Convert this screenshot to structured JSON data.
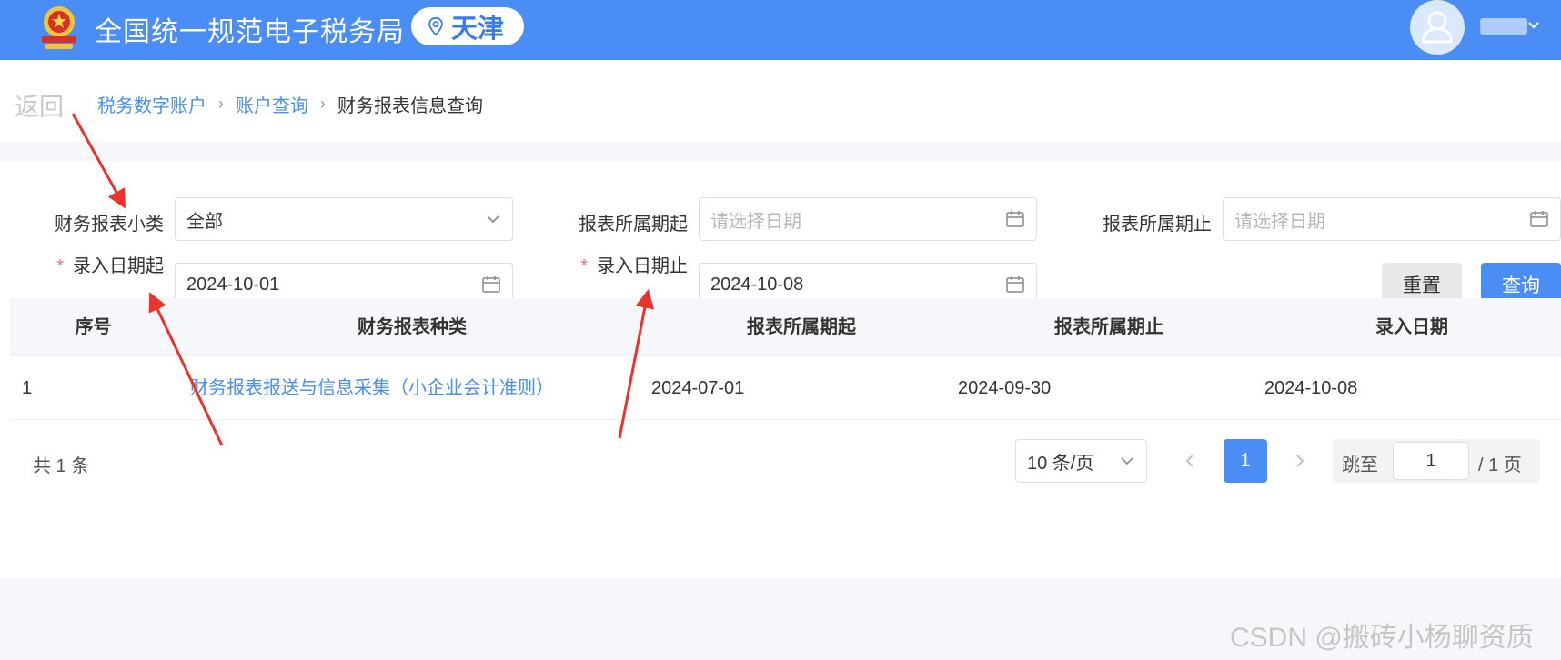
{
  "header": {
    "app_title": "全国统一规范电子税务局",
    "region": "天津",
    "emblem_icon": "tax-emblem-icon",
    "user_icon": "user-avatar-icon"
  },
  "breadcrumb": {
    "back": "返回",
    "items": [
      "税务数字账户",
      "账户查询"
    ],
    "current": "财务报表信息查询"
  },
  "filters": {
    "report_subtype": {
      "label": "财务报表小类",
      "value": "全部"
    },
    "period_start": {
      "label": "报表所属期起",
      "placeholder": "请选择日期"
    },
    "period_end": {
      "label": "报表所属期止",
      "placeholder": "请选择日期"
    },
    "entry_start": {
      "required": "*",
      "label": "录入日期起",
      "value": "2024-10-01"
    },
    "entry_end": {
      "required": "*",
      "label": "录入日期止",
      "value": "2024-10-08"
    },
    "reset_label": "重置",
    "query_label": "查询"
  },
  "table": {
    "columns": [
      "序号",
      "财务报表种类",
      "报表所属期起",
      "报表所属期止",
      "录入日期"
    ],
    "rows": [
      [
        "1",
        "财务报表报送与信息采集（小企业会计准则）",
        "2024-07-01",
        "2024-09-30",
        "2024-10-08"
      ]
    ]
  },
  "pagination": {
    "total": "共 1 条",
    "page_size": "10 条/页",
    "current_page": "1",
    "jump_label": "跳至",
    "jump_value": "1",
    "total_pages": "/ 1 页"
  },
  "watermark": "CSDN @搬砖小杨聊资质",
  "colors": {
    "primary": "#4a8df5",
    "annotation_arrow": "#e8342c",
    "required": "#f56c6c"
  }
}
